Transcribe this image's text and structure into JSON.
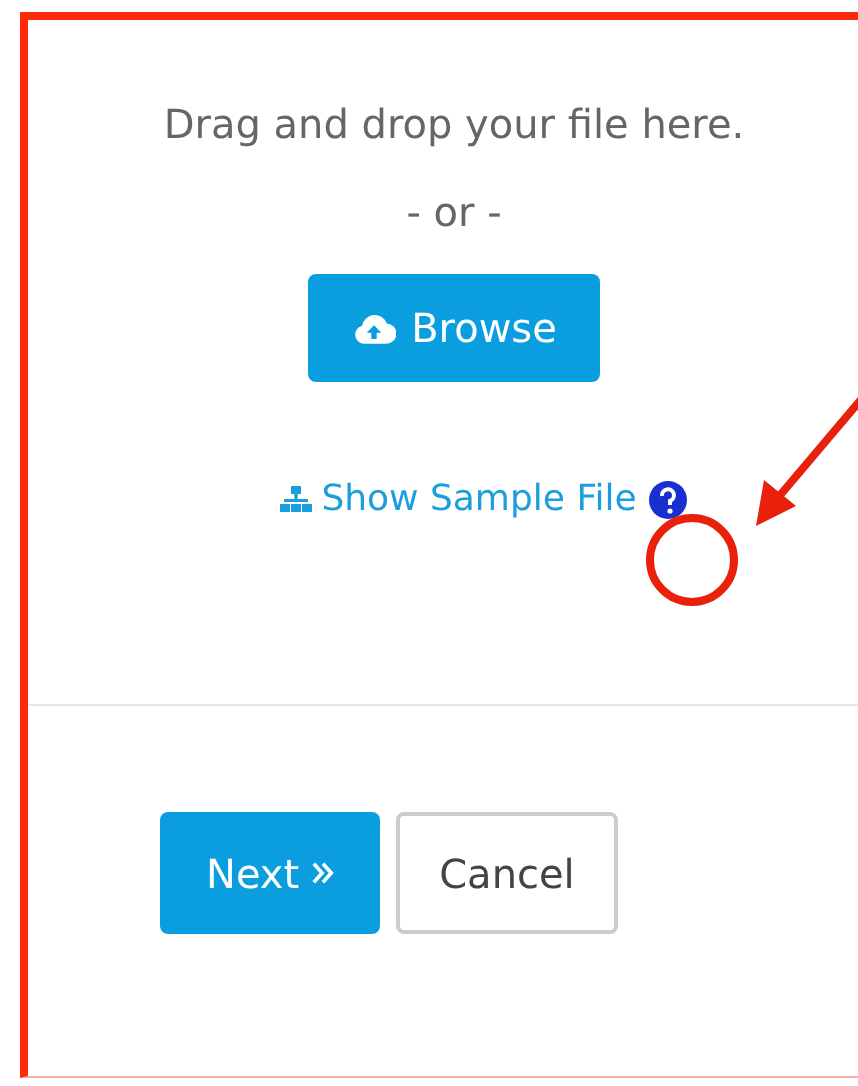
{
  "upload": {
    "prompt": "Drag and drop your file here.",
    "separator": "- or -",
    "browse_button": "Browse",
    "sample_link": "Show Sample File"
  },
  "buttons": [
    {
      "label": "Next",
      "kind": "primary"
    },
    {
      "label": "Cancel",
      "kind": "secondary"
    }
  ]
}
